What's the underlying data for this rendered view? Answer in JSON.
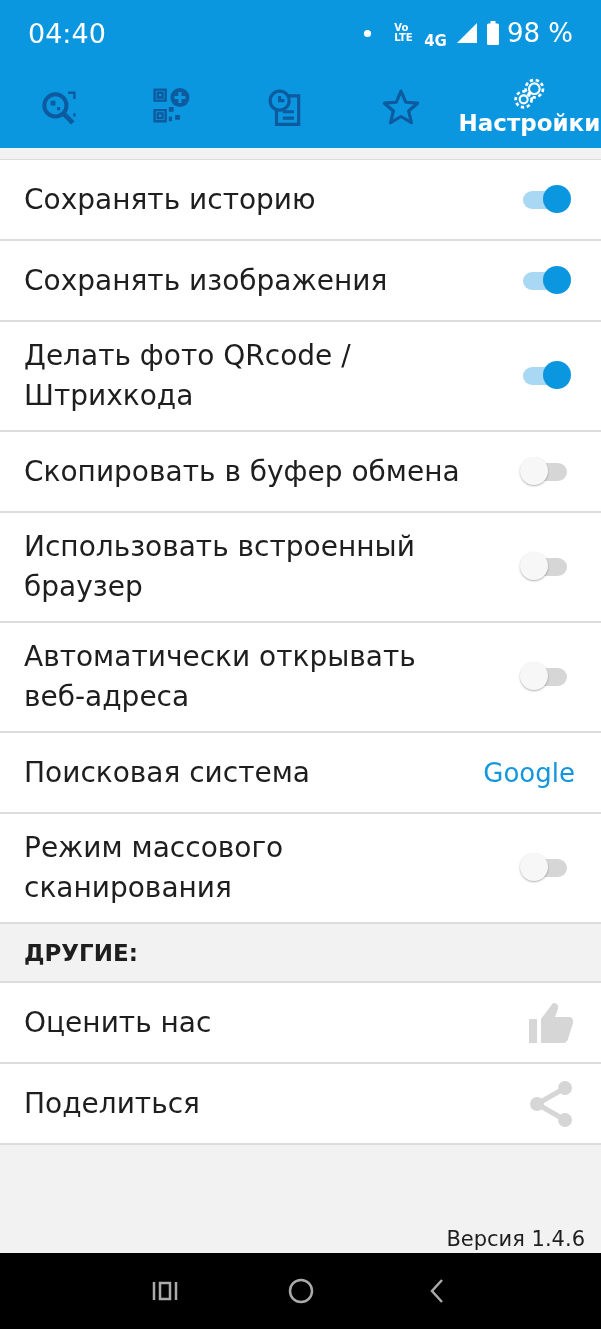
{
  "status_bar": {
    "time": "04:40",
    "network": "4G",
    "volte": "Vo LTE",
    "battery": "98 %"
  },
  "tabs": [
    {
      "selected": false,
      "kind": "scan"
    },
    {
      "selected": false,
      "kind": "create"
    },
    {
      "selected": false,
      "kind": "history"
    },
    {
      "selected": false,
      "kind": "favorites"
    },
    {
      "selected": true,
      "kind": "settings",
      "label": "Настройки"
    }
  ],
  "settings": [
    {
      "kind": "toggle",
      "label": "Сохранять историю",
      "on": true
    },
    {
      "kind": "toggle",
      "label": "Сохранять изображения",
      "on": true
    },
    {
      "kind": "toggle",
      "label": "Делать фото QRcode / Штрихкода",
      "on": true
    },
    {
      "kind": "toggle",
      "label": "Скопировать в буфер обмена",
      "on": false
    },
    {
      "kind": "toggle",
      "label": "Использовать встроенный браузер",
      "on": false
    },
    {
      "kind": "toggle",
      "label": "Автоматически открывать веб-адреса",
      "on": false
    },
    {
      "kind": "value",
      "label": "Поисковая система",
      "value": "Google"
    },
    {
      "kind": "toggle",
      "label": "Режим массового сканирования",
      "on": false
    }
  ],
  "other_section": {
    "title": "ДРУГИЕ:",
    "items": [
      {
        "kind": "rate",
        "label": "Оценить нас"
      },
      {
        "kind": "share",
        "label": "Поделиться"
      }
    ]
  },
  "footer": {
    "version": "Версия 1.4.6"
  }
}
